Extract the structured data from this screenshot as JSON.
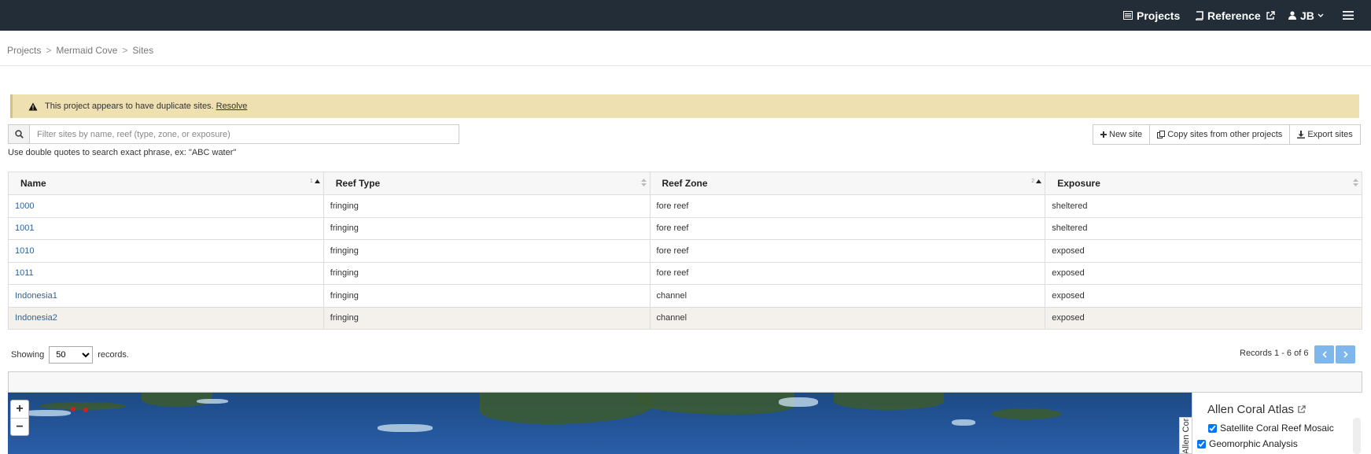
{
  "nav": {
    "projects": "Projects",
    "reference": "Reference",
    "user": "JB"
  },
  "breadcrumb": [
    "Projects",
    "Mermaid Cove",
    "Sites"
  ],
  "alert": {
    "message": "This project appears to have duplicate sites.",
    "action": "Resolve"
  },
  "search": {
    "placeholder": "Filter sites by name, reef (type, zone, or exposure)",
    "hint": "Use double quotes to search exact phrase, ex: \"ABC water\""
  },
  "actions": {
    "new_site": "New site",
    "copy_sites": "Copy sites from other projects",
    "export_sites": "Export sites"
  },
  "table": {
    "columns": [
      {
        "label": "Name",
        "sort_order": "1"
      },
      {
        "label": "Reef Type",
        "sort_order": ""
      },
      {
        "label": "Reef Zone",
        "sort_order": "2"
      },
      {
        "label": "Exposure",
        "sort_order": ""
      }
    ],
    "rows": [
      {
        "name": "1000",
        "reef_type": "fringing",
        "reef_zone": "fore reef",
        "exposure": "sheltered"
      },
      {
        "name": "1001",
        "reef_type": "fringing",
        "reef_zone": "fore reef",
        "exposure": "sheltered"
      },
      {
        "name": "1010",
        "reef_type": "fringing",
        "reef_zone": "fore reef",
        "exposure": "exposed"
      },
      {
        "name": "1011",
        "reef_type": "fringing",
        "reef_zone": "fore reef",
        "exposure": "exposed"
      },
      {
        "name": "Indonesia1",
        "reef_type": "fringing",
        "reef_zone": "channel",
        "exposure": "exposed"
      },
      {
        "name": "Indonesia2",
        "reef_type": "fringing",
        "reef_zone": "channel",
        "exposure": "exposed"
      }
    ]
  },
  "pagination": {
    "showing_label": "Showing",
    "page_size": "50",
    "records_label": "records.",
    "summary": "Records 1 - 6 of 6"
  },
  "map": {
    "zoom_in": "+",
    "zoom_out": "−",
    "legend_tab": "Allen Coral Atlas",
    "legend_title": "Allen Coral Atlas",
    "layers": [
      "Satellite Coral Reef Mosaic",
      "Geomorphic Analysis"
    ]
  },
  "colors": {
    "topbar": "#232d38",
    "alert_bg": "#efe0b2",
    "link": "#2f6295",
    "pager": "#7fb7ec"
  }
}
